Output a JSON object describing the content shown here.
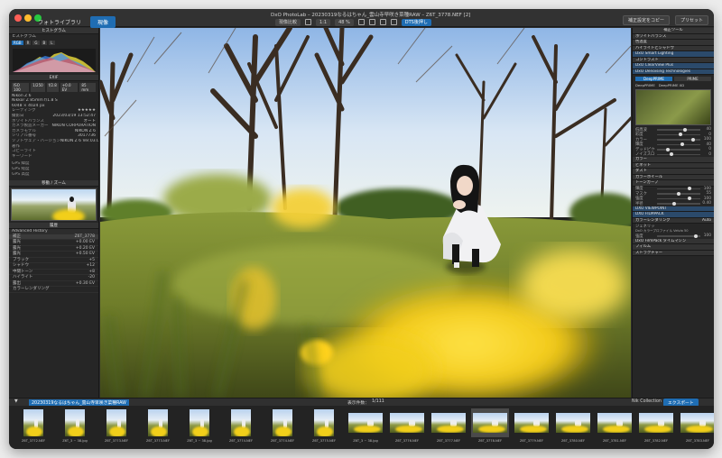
{
  "titlebar": {
    "tabs": [
      {
        "label": "フォトライブラリ"
      },
      {
        "label": "現像"
      }
    ],
    "window_title": "DxO PhotoLab – 20230319なるはちゃん_雲山寺早咲き菜種RAW – Z6T_3778.NEF [2]",
    "toolbar": {
      "compare": "現像比較",
      "ratio": "1:1",
      "zoom": "48 %",
      "export": "DTS後押し"
    },
    "right_buttons": [
      "補正設定をコピー",
      "プリセット"
    ]
  },
  "left": {
    "histogram_header": "ヒストグラム",
    "histogram_label": "ヒストグラム",
    "channels": [
      "RGB",
      "R",
      "G",
      "B",
      "L"
    ],
    "info_header": "EXIF",
    "exif_chips": [
      "ISO 100",
      "1/250",
      "f/2.8",
      "+0.0 EV",
      "85 mm"
    ],
    "camera": "Nikon Z 6",
    "lens": "Nikkor Z 85mm f/1.8 S",
    "size": "6048 × 4024 px",
    "rows": [
      {
        "k": "レーティング",
        "v": "★★★★★"
      },
      {
        "k": "撮影日",
        "v": "2023/03/19 13:52:47"
      },
      {
        "k": "ホワイトバランス",
        "v": "オート"
      },
      {
        "k": "カメラ製造メーカー",
        "v": "NIKON CORPORATION"
      },
      {
        "k": "カメラモデル",
        "v": "NIKON Z 6"
      },
      {
        "k": "シリアル番号",
        "v": "3017736"
      },
      {
        "k": "ソフトウェア・バージョン",
        "v": "NIKON Z 6 Ver.03.00"
      },
      {
        "k": "著作",
        "v": ""
      },
      {
        "k": "コピーライト",
        "v": ""
      },
      {
        "k": "キーワード",
        "v": ""
      }
    ],
    "gps": [
      "GPS 緯度",
      "GPS 経度",
      "GPS 高度"
    ],
    "nav_header": "移動 / ズーム",
    "history_header": "履歴",
    "history_mode": "Advanced History",
    "history": [
      {
        "label": "補正",
        "v": "Z6T_3778"
      },
      {
        "label": "露光",
        "v": "+0.00 EV"
      },
      {
        "label": "露光",
        "v": "+0.20 EV"
      },
      {
        "label": "露光",
        "v": "+0.50 EV"
      },
      {
        "label": "ブラック",
        "v": "+5"
      },
      {
        "label": "シャドウ",
        "v": "+12"
      },
      {
        "label": "中間トーン",
        "v": "+8"
      },
      {
        "label": "ハイライト",
        "v": "-20"
      },
      {
        "label": "露出",
        "v": "+0.30 EV"
      },
      {
        "label": "カラーレンダリング",
        "v": ""
      }
    ]
  },
  "right": {
    "header": "補正ツール",
    "sections": [
      {
        "label": "ホワイトバランス",
        "hl": false
      },
      {
        "label": "色温度",
        "hl": false
      },
      {
        "label": "ハイライトとシャドウ",
        "hl": false
      },
      {
        "label": "DxO Smart Lighting",
        "hl": true
      },
      {
        "label": "コントラスト",
        "hl": false
      },
      {
        "label": "DxO ClearView Plus",
        "hl": true
      },
      {
        "label": "DxO Denoising Technologies",
        "hl": true
      }
    ],
    "denoise": {
      "mode_a": "DeepPRIME",
      "mode_b": "PRIME",
      "opt_a": "DeepPRIME",
      "opt_b": "DeepPRIME XD"
    },
    "sliders": [
      {
        "label": "低周波",
        "value": "40",
        "pct": 0.6
      },
      {
        "label": "彩度",
        "value": "0",
        "pct": 0.5
      },
      {
        "label": "カラー",
        "value": "100",
        "pct": 0.8
      },
      {
        "label": "輝度",
        "value": "40",
        "pct": 0.55
      },
      {
        "label": "デッドピクセル",
        "value": "0",
        "pct": 0.2
      },
      {
        "label": "ノイズスロープ",
        "value": "0",
        "pct": 0.3
      }
    ],
    "sections2": [
      "カラー",
      "ビネット",
      "ダスト",
      "カラーホイール",
      "トーンカーブ"
    ],
    "sliders2": [
      {
        "label": "輝度",
        "value": "100",
        "pct": 0.7
      },
      {
        "label": "マスク",
        "value": "55",
        "pct": 0.45
      },
      {
        "label": "強度",
        "value": "100",
        "pct": 0.7
      },
      {
        "label": "半径",
        "value": "0.40",
        "pct": 0.35
      }
    ],
    "viewpoint": [
      "DXO VIEWPOINT",
      "DXO FILMPACK"
    ],
    "render": {
      "label": "カラーレンダリング",
      "value": "Auto",
      "category": "ジェネリック",
      "rendering": "DxO カラープロファイル Velvia 50",
      "intensity": "100"
    },
    "footer": [
      "DxO FilmPack タイムマシン",
      "フィルム",
      "ストラクチャー"
    ]
  },
  "filmstrip": {
    "path": "20230319なるはちゃん_雲山寺早咲き菜種RAW",
    "count": "表示件数：",
    "of": "1/111",
    "nik": "Nik Collection",
    "export_btn": "エクスポート",
    "thumbs": [
      {
        "name": "Z6T_3772.NEF",
        "orient": "p",
        "sel": false
      },
      {
        "name": "Z6T_3 ~ 38.jpg",
        "orient": "p",
        "sel": false
      },
      {
        "name": "Z6T_3773.NEF",
        "orient": "p",
        "sel": false
      },
      {
        "name": "Z6T_3773.NEF",
        "orient": "p",
        "sel": false
      },
      {
        "name": "Z6T_3 ~ 38.jpg",
        "orient": "p",
        "sel": false
      },
      {
        "name": "Z6T_3774.NEF",
        "orient": "p",
        "sel": false
      },
      {
        "name": "Z6T_3774.NEF",
        "orient": "p",
        "sel": false
      },
      {
        "name": "Z6T_3775.NEF",
        "orient": "p",
        "sel": false
      },
      {
        "name": "Z6T_3 ~ 38.jpg",
        "orient": "l",
        "sel": false
      },
      {
        "name": "Z6T_3776.NEF",
        "orient": "l",
        "sel": false
      },
      {
        "name": "Z6T_3777.NEF",
        "orient": "l",
        "sel": false
      },
      {
        "name": "Z6T_3778.NEF",
        "orient": "l",
        "sel": true
      },
      {
        "name": "Z6T_3779.NEF",
        "orient": "l",
        "sel": false
      },
      {
        "name": "Z6T_3780.NEF",
        "orient": "l",
        "sel": false
      },
      {
        "name": "Z6T_3781.NEF",
        "orient": "l",
        "sel": false
      },
      {
        "name": "Z6T_3782.NEF",
        "orient": "l",
        "sel": false
      },
      {
        "name": "Z6T_3783.NEF",
        "orient": "l",
        "sel": false
      }
    ]
  },
  "colors": {
    "accent": "#1f6db3",
    "panel": "#262626",
    "chrome": "#323232",
    "flower": "#f2cf1a"
  }
}
